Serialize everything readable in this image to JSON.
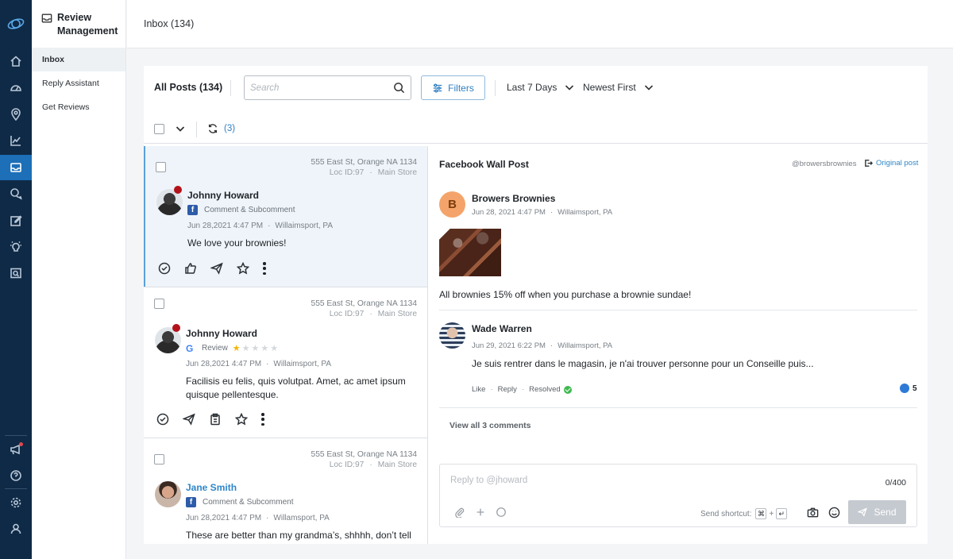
{
  "colors": {
    "rail": "#0f2a47",
    "accent": "#1d6fb8",
    "link": "#2f87c9",
    "notify": "#e5484d"
  },
  "sidebar_icons": [
    "logo-icon",
    "home-icon",
    "dashboard-icon",
    "location-icon",
    "chart-icon",
    "inbox-icon",
    "chat-icon",
    "edit-icon",
    "idea-icon",
    "search-page-icon",
    "announcement-icon",
    "help-icon",
    "settings-icon",
    "user-icon"
  ],
  "subnav": {
    "title": "Review Management",
    "items": [
      {
        "label": "Inbox",
        "active": true
      },
      {
        "label": "Reply Assistant",
        "active": false
      },
      {
        "label": "Get Reviews",
        "active": false
      }
    ]
  },
  "header": {
    "title": "Inbox (134)"
  },
  "toolbar": {
    "all_posts": "All Posts (134)",
    "search_placeholder": "Search",
    "filters_label": "Filters",
    "date_range": "Last 7 Days",
    "sort": "Newest First",
    "refresh_count": "(3)"
  },
  "posts": [
    {
      "address": "555 East St, Orange NA 1134",
      "loc_id": "Loc ID:97",
      "store": "Main Store",
      "name": "Johnny Howard",
      "source": "Comment & Subcomment",
      "date": "Jun 28,2021 4:47 PM",
      "city": "Willaimsport, PA",
      "text": "We love your brownies!"
    },
    {
      "address": "555 East St, Orange NA 1134",
      "loc_id": "Loc ID:97",
      "store": "Main Store",
      "name": "Johnny Howard",
      "source": "Review",
      "rating": 1,
      "date": "Jun 28,2021 4:47 PM",
      "city": "Willaimsport, PA",
      "text": "Facilisis eu felis, quis volutpat. Amet, ac amet ipsum quisque pellentesque."
    },
    {
      "address": "555 East St, Orange NA 1134",
      "loc_id": "Loc ID:97",
      "store": "Main Store",
      "name": "Jane Smith",
      "source": "Comment & Subcomment",
      "date": "Jun 28,2021 4:47 PM",
      "city": "Willamsport, PA",
      "text": "These are better than my grandma’s, shhhh, don’t tell"
    }
  ],
  "detail": {
    "title": "Facebook Wall Post",
    "handle": "@browersbrownies",
    "original_post": "Original post",
    "author_initial": "B",
    "author": "Browers Brownies",
    "date": "Jun 28, 2021 4:47 PM",
    "city": "Willaimsport, PA",
    "body": "All brownies 15% off when you purchase a brownie sundae!",
    "comment": {
      "author": "Wade Warren",
      "date": "Jun 29, 2021 6:22 PM",
      "city": "Willaimsport, PA",
      "text": "Je suis rentrer dans le magasin, je n'ai trouver personne pour un Conseille puis...",
      "like": "Like",
      "reply": "Reply",
      "status": "Resolved",
      "likes": "5"
    },
    "view_all": "View all 3 comments",
    "reply_box": {
      "placeholder": "Reply to @jhoward",
      "counter": "0/400",
      "shortcut_label": "Send shortcut:",
      "key_cmd": "⌘",
      "key_plus": "+",
      "key_enter": "↵",
      "send": "Send"
    }
  }
}
